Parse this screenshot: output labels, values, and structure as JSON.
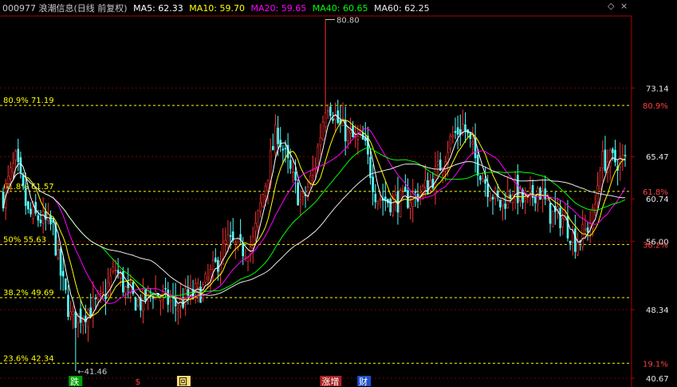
{
  "header": {
    "title": "000977 浪潮信息(日线 前复权)",
    "ma": [
      {
        "text": "MA5: 62.33",
        "color": "#ffffff"
      },
      {
        "text": "MA10: 59.70",
        "color": "#ffff00"
      },
      {
        "text": "MA20: 59.65",
        "color": "#ff00ff"
      },
      {
        "text": "MA40: 60.65",
        "color": "#00ff00"
      },
      {
        "text": "MA60: 62.25",
        "color": "#e8e8e8"
      }
    ],
    "ctl_diamond": "◇",
    "ctl_x": "×"
  },
  "colors": {
    "up": "#ff3232",
    "down": "#54ffff",
    "grid": "#7a0000",
    "fib": "#ffff00",
    "axis": "#b00000"
  },
  "chart_data": {
    "type": "candlestick",
    "ylim": [
      40.67,
      81.2
    ],
    "y_tick_labels": [
      {
        "value": 73.14,
        "label": "73.14"
      },
      {
        "value": 65.47,
        "label": "65.47"
      },
      {
        "value": 60.74,
        "label": "60.74"
      },
      {
        "value": 56.0,
        "label": "56.00"
      },
      {
        "value": 48.34,
        "label": "48.34"
      },
      {
        "value": 40.67,
        "label": "40.67"
      }
    ],
    "fib_levels": [
      {
        "value": 71.19,
        "left_label": "80.9% 71.19",
        "right_label": "80.9%"
      },
      {
        "value": 61.57,
        "left_label": "61.8% 61.57",
        "right_label": "61.8%"
      },
      {
        "value": 55.63,
        "left_label": "50% 55.63",
        "right_label": "38.2%"
      },
      {
        "value": 49.69,
        "left_label": "38.2% 49.69",
        "right_label": ""
      },
      {
        "value": 42.34,
        "left_label": "23.6% 42.34",
        "right_label": "19.1%"
      }
    ],
    "high_note": {
      "value": 80.8,
      "label": "80.80",
      "at": 0.518
    },
    "low_note": {
      "value": 41.46,
      "label": "←41.46",
      "at": 0.117
    },
    "events": [
      {
        "text": "跌",
        "at": 0.108,
        "bg": "#00a000",
        "fg": "#ffffff"
      },
      {
        "text": "$",
        "at": 0.212,
        "bg": "#000000",
        "fg": "#ff3232"
      },
      {
        "text": "回",
        "at": 0.282,
        "bg": "#ffdd77",
        "fg": "#000000"
      },
      {
        "text": "涨增",
        "at": 0.512,
        "bg": "#aa2222",
        "fg": "#ffffff"
      },
      {
        "text": "财",
        "at": 0.572,
        "bg": "#1e50c8",
        "fg": "#ffffff"
      }
    ],
    "n_bars": 250,
    "path_points": [
      [
        0,
        61
      ],
      [
        0.02,
        65
      ],
      [
        0.04,
        59
      ],
      [
        0.06,
        58.5
      ],
      [
        0.08,
        57.5
      ],
      [
        0.09,
        53
      ],
      [
        0.11,
        47
      ],
      [
        0.12,
        47.5
      ],
      [
        0.14,
        48.5
      ],
      [
        0.16,
        49.5
      ],
      [
        0.18,
        53
      ],
      [
        0.2,
        50
      ],
      [
        0.22,
        49
      ],
      [
        0.24,
        50.5
      ],
      [
        0.26,
        49.5
      ],
      [
        0.28,
        48.8
      ],
      [
        0.3,
        50
      ],
      [
        0.32,
        50.5
      ],
      [
        0.34,
        53
      ],
      [
        0.36,
        56
      ],
      [
        0.38,
        55
      ],
      [
        0.4,
        55.5
      ],
      [
        0.42,
        62
      ],
      [
        0.44,
        68.5
      ],
      [
        0.46,
        64
      ],
      [
        0.48,
        60
      ],
      [
        0.5,
        64
      ],
      [
        0.52,
        72
      ],
      [
        0.54,
        69
      ],
      [
        0.56,
        67.5
      ],
      [
        0.58,
        67
      ],
      [
        0.6,
        61
      ],
      [
        0.62,
        60.5
      ],
      [
        0.64,
        60.5
      ],
      [
        0.66,
        61
      ],
      [
        0.68,
        62
      ],
      [
        0.7,
        64
      ],
      [
        0.72,
        67.5
      ],
      [
        0.74,
        69
      ],
      [
        0.76,
        65
      ],
      [
        0.78,
        62
      ],
      [
        0.8,
        60
      ],
      [
        0.82,
        62
      ],
      [
        0.84,
        60
      ],
      [
        0.86,
        62
      ],
      [
        0.88,
        59
      ],
      [
        0.9,
        58.5
      ],
      [
        0.92,
        56
      ],
      [
        0.935,
        57
      ],
      [
        0.95,
        59
      ],
      [
        0.96,
        65
      ]
    ]
  }
}
